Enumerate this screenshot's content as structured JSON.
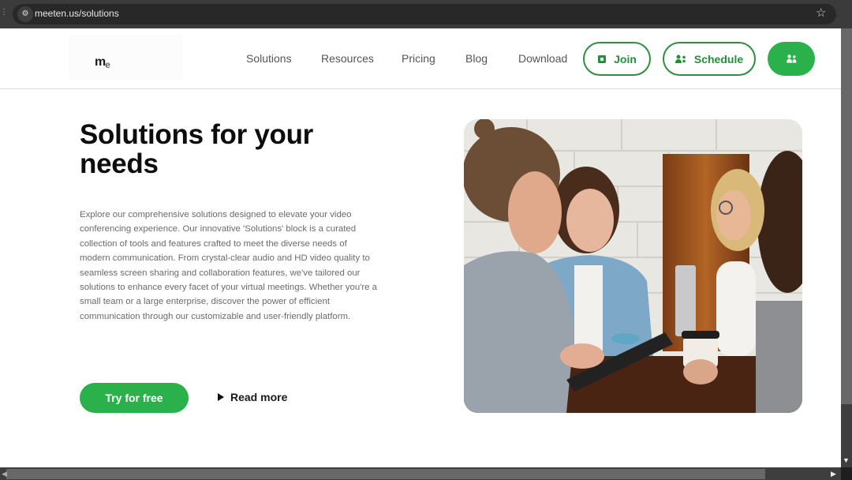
{
  "browser": {
    "url": "meeten.us/solutions",
    "site_info_icon": "tune-icon",
    "bookmark_icon": "star-icon"
  },
  "header": {
    "logo": {
      "main": "m",
      "sub": "e"
    },
    "nav": [
      {
        "label": "Solutions"
      },
      {
        "label": "Resources"
      },
      {
        "label": "Pricing"
      },
      {
        "label": "Blog"
      },
      {
        "label": "Download"
      }
    ],
    "join_label": "Join",
    "schedule_label": "Schedule",
    "account_icon": "people-icon"
  },
  "hero": {
    "title": "Solutions for your needs",
    "body": "Explore our comprehensive solutions designed to elevate your video conferencing experience. Our innovative 'Solutions' block is a curated collection of tools and features crafted to meet the diverse needs of modern communication. From crystal-clear audio and HD video quality to seamless screen sharing and collaboration features, we've tailored our solutions to enhance every facet of your virtual meetings. Whether you're a small team or a large enterprise, discover the power of efficient communication through our customizable and user-friendly platform.",
    "primary_cta": "Try for free",
    "secondary_cta": "Read more",
    "image_alt": "Four people smiling around a cafe table with a tablet, laptop and coffee cups"
  },
  "colors": {
    "brand_green": "#2bb14b",
    "outline_green": "#2f8f3e",
    "heading": "#0d0d0d",
    "body_text": "#6b6b6b"
  }
}
